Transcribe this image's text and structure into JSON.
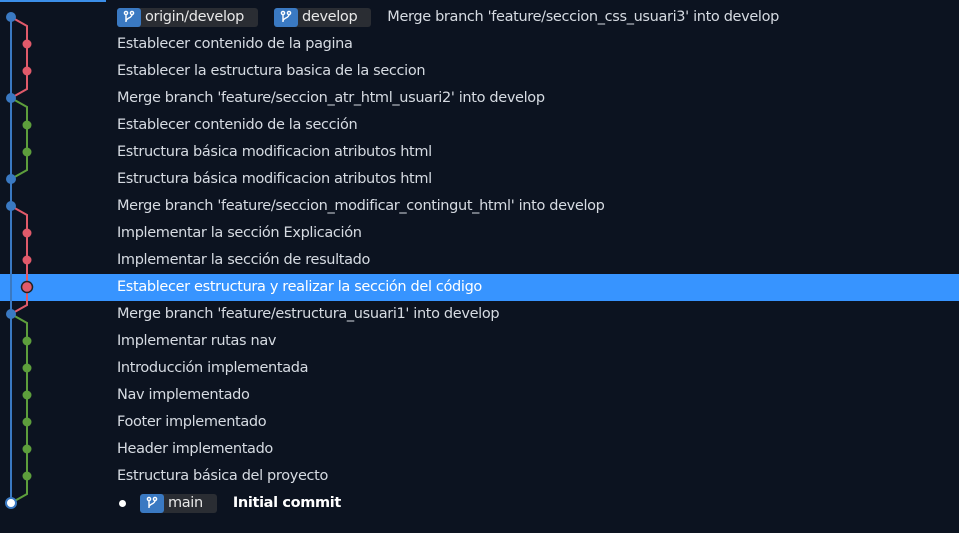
{
  "colors": {
    "develop": "#3a79c2",
    "feature_a": "#e05a6a",
    "feature_b": "#5d9e3c",
    "selection": "#3794ff"
  },
  "top_refs": [
    {
      "icon": "branch-icon",
      "label": "origin/develop"
    },
    {
      "icon": "branch-icon",
      "label": "develop"
    }
  ],
  "bottom_refs": [
    {
      "icon": "branch-icon",
      "label": "main"
    }
  ],
  "commits": [
    {
      "message": "Merge branch 'feature/seccion_css_usuari3' into develop",
      "lane": 0
    },
    {
      "message": "Establecer contenido de la pagina",
      "lane": 1,
      "color": "feature_a"
    },
    {
      "message": "Establecer la estructura basica de la seccion",
      "lane": 1,
      "color": "feature_a"
    },
    {
      "message": "Merge branch 'feature/seccion_atr_html_usuari2' into develop",
      "lane": 0
    },
    {
      "message": "Establecer contenido de la sección",
      "lane": 1,
      "color": "feature_b"
    },
    {
      "message": "Estructura básica modificacion atributos html",
      "lane": 1,
      "color": "feature_b"
    },
    {
      "message": "Estructura básica modificacion atributos html",
      "lane": 0
    },
    {
      "message": "Merge branch 'feature/seccion_modificar_contingut_html' into develop",
      "lane": 0
    },
    {
      "message": "Implementar la sección Explicación",
      "lane": 1,
      "color": "feature_a"
    },
    {
      "message": "Implementar la sección de resultado",
      "lane": 1,
      "color": "feature_a"
    },
    {
      "message": "Establecer estructura y realizar la sección del código",
      "lane": 1,
      "color": "feature_a",
      "selected": true
    },
    {
      "message": "Merge branch 'feature/estructura_usuari1' into develop",
      "lane": 0
    },
    {
      "message": "Implementar rutas nav",
      "lane": 1,
      "color": "feature_b"
    },
    {
      "message": "Introducción implementada",
      "lane": 1,
      "color": "feature_b"
    },
    {
      "message": "Nav implementado",
      "lane": 1,
      "color": "feature_b"
    },
    {
      "message": "Footer implementado",
      "lane": 1,
      "color": "feature_b"
    },
    {
      "message": "Header implementado",
      "lane": 1,
      "color": "feature_b"
    },
    {
      "message": "Estructura básica del proyecto",
      "lane": 1,
      "color": "feature_b"
    },
    {
      "message": "Initial commit",
      "lane": 0,
      "head": true
    }
  ]
}
